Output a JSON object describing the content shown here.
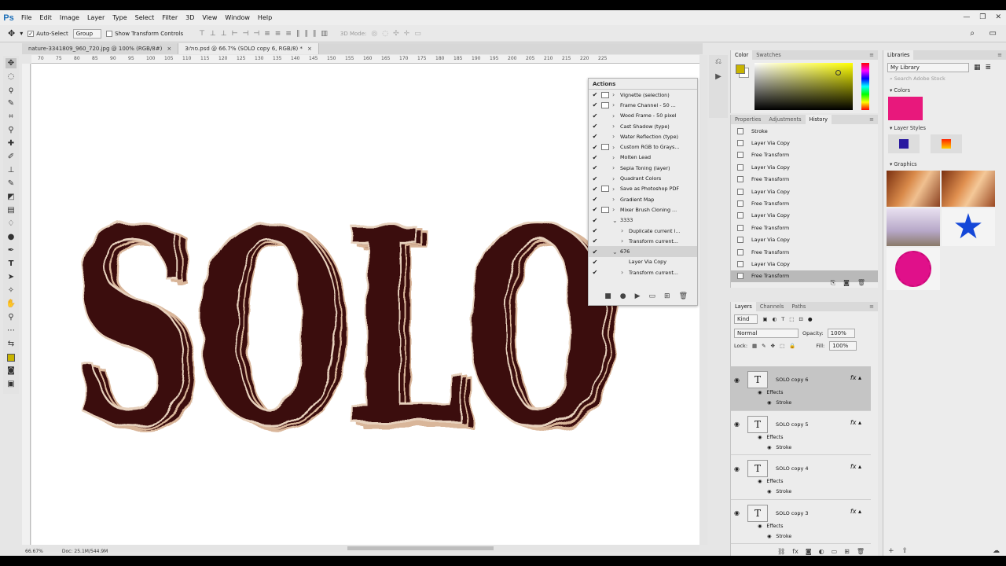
{
  "menu": {
    "logo": "Ps",
    "items": [
      "File",
      "Edit",
      "Image",
      "Layer",
      "Type",
      "Select",
      "Filter",
      "3D",
      "View",
      "Window",
      "Help"
    ]
  },
  "options": {
    "auto_select": "Auto-Select",
    "group": "Group",
    "show_transform": "Show Transform Controls",
    "mode3d": "3D Mode:"
  },
  "tabs": [
    {
      "label": "nature-3341809_960_720.jpg @ 100% (RGB/8#)",
      "active": false
    },
    {
      "label": "3סולו.psd @ 66.7% (SOLO copy 6, RGB/8) *",
      "active": true
    }
  ],
  "ruler_marks": [
    "70",
    "75",
    "80",
    "85",
    "90",
    "95",
    "100",
    "105",
    "110",
    "115",
    "120",
    "125",
    "130",
    "135",
    "140",
    "145",
    "150",
    "155",
    "160",
    "165",
    "170",
    "175",
    "180",
    "185",
    "190",
    "195",
    "200",
    "205",
    "210",
    "215",
    "220",
    "225"
  ],
  "canvas_text": "SOLO",
  "colors": {
    "letter": "#3a0a0c",
    "stroke": "#d9b69a",
    "fg": "#c8b400",
    "pink": "#e8187c"
  },
  "status": {
    "zoom": "66.67%",
    "doc": "Doc: 25.1M/544.9M"
  },
  "actions": {
    "title": "Actions",
    "rows": [
      {
        "check": "✔",
        "dlg": true,
        "arrow": "›",
        "label": "Vignette (selection)",
        "sub": false,
        "sel": false
      },
      {
        "check": "✔",
        "dlg": true,
        "arrow": "›",
        "label": "Frame Channel - 50 ...",
        "sub": false,
        "sel": false
      },
      {
        "check": "✔",
        "dlg": false,
        "arrow": "›",
        "label": "Wood Frame - 50 pixel",
        "sub": false,
        "sel": false
      },
      {
        "check": "✔",
        "dlg": false,
        "arrow": "›",
        "label": "Cast Shadow (type)",
        "sub": false,
        "sel": false
      },
      {
        "check": "✔",
        "dlg": false,
        "arrow": "›",
        "label": "Water Reflection (type)",
        "sub": false,
        "sel": false
      },
      {
        "check": "✔",
        "dlg": true,
        "arrow": "›",
        "label": "Custom RGB to Grays...",
        "sub": false,
        "sel": false
      },
      {
        "check": "✔",
        "dlg": false,
        "arrow": "›",
        "label": "Molten Lead",
        "sub": false,
        "sel": false
      },
      {
        "check": "✔",
        "dlg": false,
        "arrow": "›",
        "label": "Sepia Toning (layer)",
        "sub": false,
        "sel": false
      },
      {
        "check": "✔",
        "dlg": false,
        "arrow": "›",
        "label": "Quadrant Colors",
        "sub": false,
        "sel": false
      },
      {
        "check": "✔",
        "dlg": true,
        "arrow": "›",
        "label": "Save as Photoshop PDF",
        "sub": false,
        "sel": false
      },
      {
        "check": "✔",
        "dlg": false,
        "arrow": "›",
        "label": "Gradient Map",
        "sub": false,
        "sel": false
      },
      {
        "check": "✔",
        "dlg": true,
        "arrow": "›",
        "label": "Mixer Brush Cloning ...",
        "sub": false,
        "sel": false
      },
      {
        "check": "✔",
        "dlg": false,
        "arrow": "⌄",
        "label": "3333",
        "sub": false,
        "sel": false
      },
      {
        "check": "✔",
        "dlg": false,
        "arrow": "›",
        "label": "Duplicate current l...",
        "sub": true,
        "sel": false
      },
      {
        "check": "✔",
        "dlg": false,
        "arrow": "›",
        "label": "Transform current...",
        "sub": true,
        "sel": false
      },
      {
        "check": "✔",
        "dlg": false,
        "arrow": "⌄",
        "label": "676",
        "sub": false,
        "sel": true
      },
      {
        "check": "✔",
        "dlg": false,
        "arrow": "",
        "label": "Layer Via Copy",
        "sub": true,
        "sel": false
      },
      {
        "check": "✔",
        "dlg": false,
        "arrow": "›",
        "label": "Transform current...",
        "sub": true,
        "sel": false
      }
    ]
  },
  "color_panel": {
    "tabs": [
      "Color",
      "Swatches"
    ]
  },
  "history": {
    "tabs": [
      "Properties",
      "Adjustments",
      "History"
    ],
    "rows": [
      "Stroke",
      "Layer Via Copy",
      "Free Transform",
      "Layer Via Copy",
      "Free Transform",
      "Layer Via Copy",
      "Free Transform",
      "Layer Via Copy",
      "Free Transform",
      "Layer Via Copy",
      "Free Transform",
      "Layer Via Copy",
      "Free Transform"
    ]
  },
  "layers": {
    "tabs": [
      "Layers",
      "Channels",
      "Paths"
    ],
    "kind": "Kind",
    "blend": "Normal",
    "opacity_label": "Opacity:",
    "opacity": "100%",
    "lock_label": "Lock:",
    "fill_label": "Fill:",
    "fill": "100%",
    "effects": "Effects",
    "stroke": "Stroke",
    "items": [
      "SOLO copy 6",
      "SOLO copy 5",
      "SOLO copy 4",
      "SOLO copy 3"
    ]
  },
  "libraries": {
    "title": "Libraries",
    "library": "My Library",
    "search": "Search Adobe Stock",
    "colors": "Colors",
    "layer_styles": "Layer Styles",
    "graphics": "Graphics"
  }
}
